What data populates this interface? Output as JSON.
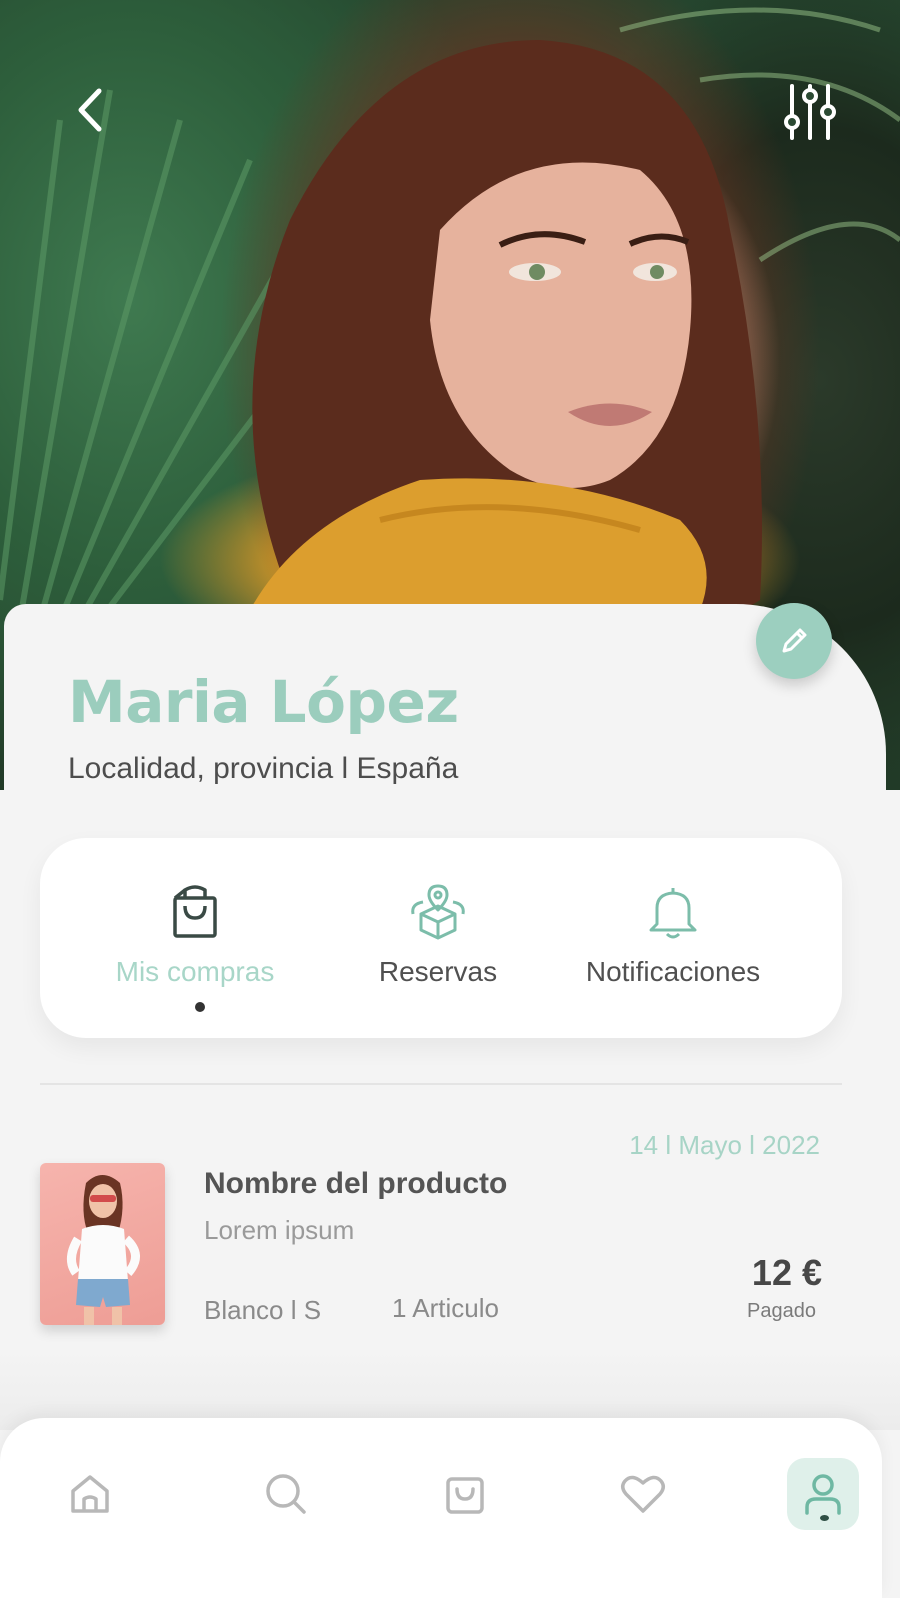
{
  "profile": {
    "name": "Maria López",
    "location": "Localidad, provincia l España"
  },
  "tabs": [
    {
      "label": "Mis compras",
      "icon": "shopping-bag-icon",
      "active": true
    },
    {
      "label": "Reservas",
      "icon": "package-location-icon",
      "active": false
    },
    {
      "label": "Notificaciones",
      "icon": "bell-icon",
      "active": false
    }
  ],
  "order": {
    "date": "14 l Mayo l 2022",
    "title": "Nombre del producto",
    "subtitle": "Lorem ipsum",
    "variant": "Blanco l S",
    "quantity": "1 Articulo",
    "price": "12 €",
    "status": "Pagado"
  },
  "nav": [
    {
      "icon": "home-icon"
    },
    {
      "icon": "search-icon"
    },
    {
      "icon": "bag-icon"
    },
    {
      "icon": "heart-icon"
    },
    {
      "icon": "user-icon",
      "active": true
    }
  ],
  "colors": {
    "accent": "#9bcdbd",
    "accent_light": "#dff0ea",
    "background": "#f4f4f4",
    "text_dark": "#4d4d4d"
  }
}
